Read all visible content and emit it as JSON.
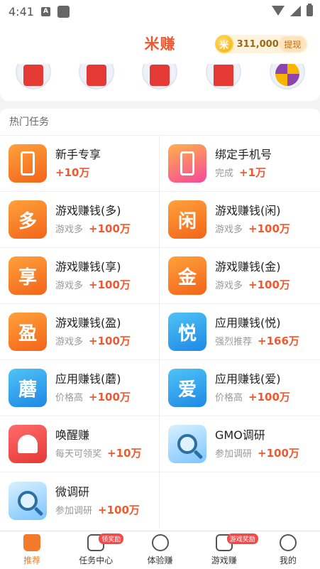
{
  "status_bar": {
    "time": "4:41",
    "notif_letter": "A"
  },
  "header": {
    "title": "米赚",
    "coin_symbol": "米",
    "coin_amount": "311,000",
    "withdraw_label": "提现"
  },
  "section": {
    "title": "热门任务"
  },
  "tasks": [
    {
      "title": "新手专享",
      "desc": "",
      "reward": "+10万",
      "icon": "phone-hand-icon",
      "glyph": ""
    },
    {
      "title": "绑定手机号",
      "desc": "完成",
      "reward": "+1万",
      "icon": "phone-link-icon",
      "glyph": ""
    },
    {
      "title": "游戏赚钱(多)",
      "desc": "游戏多",
      "reward": "+100万",
      "icon": "duo-icon",
      "glyph": "多"
    },
    {
      "title": "游戏赚钱(闲)",
      "desc": "游戏多",
      "reward": "+100万",
      "icon": "xian-icon",
      "glyph": "闲"
    },
    {
      "title": "游戏赚钱(享)",
      "desc": "游戏多",
      "reward": "+100万",
      "icon": "xiang-icon",
      "glyph": "享"
    },
    {
      "title": "游戏赚钱(金)",
      "desc": "游戏多",
      "reward": "+100万",
      "icon": "jin-icon",
      "glyph": "金"
    },
    {
      "title": "游戏赚钱(盈)",
      "desc": "游戏多",
      "reward": "+100万",
      "icon": "ying-icon",
      "glyph": "盈"
    },
    {
      "title": "应用赚钱(悦)",
      "desc": "强烈推荐",
      "reward": "+166万",
      "icon": "yue-icon",
      "glyph": "悦"
    },
    {
      "title": "应用赚钱(蘑)",
      "desc": "价格高",
      "reward": "+100万",
      "icon": "mo-icon",
      "glyph": "蘑"
    },
    {
      "title": "应用赚钱(爱)",
      "desc": "价格高",
      "reward": "+100万",
      "icon": "ai-icon",
      "glyph": "爱"
    },
    {
      "title": "唤醒赚",
      "desc": "每天可领奖",
      "reward": "+10万",
      "icon": "bell-icon",
      "glyph": ""
    },
    {
      "title": "GMO调研",
      "desc": "参加调研",
      "reward": "+100万",
      "icon": "magnifier-icon",
      "glyph": ""
    },
    {
      "title": "微调研",
      "desc": "参加调研",
      "reward": "+100万",
      "icon": "magnifier-icon",
      "glyph": ""
    }
  ],
  "nav": [
    {
      "label": "推荐",
      "icon": "home-icon",
      "badge": ""
    },
    {
      "label": "任务中心",
      "icon": "task-center-icon",
      "badge": "领奖励"
    },
    {
      "label": "体验赚",
      "icon": "cube-icon",
      "badge": ""
    },
    {
      "label": "游戏赚",
      "icon": "gamepad-icon",
      "badge": "游戏奖励"
    },
    {
      "label": "我的",
      "icon": "profile-icon",
      "badge": ""
    }
  ],
  "colors": {
    "brand": "#f2582f",
    "nav_active": "#f27a2a",
    "badge": "#f04b4b"
  }
}
